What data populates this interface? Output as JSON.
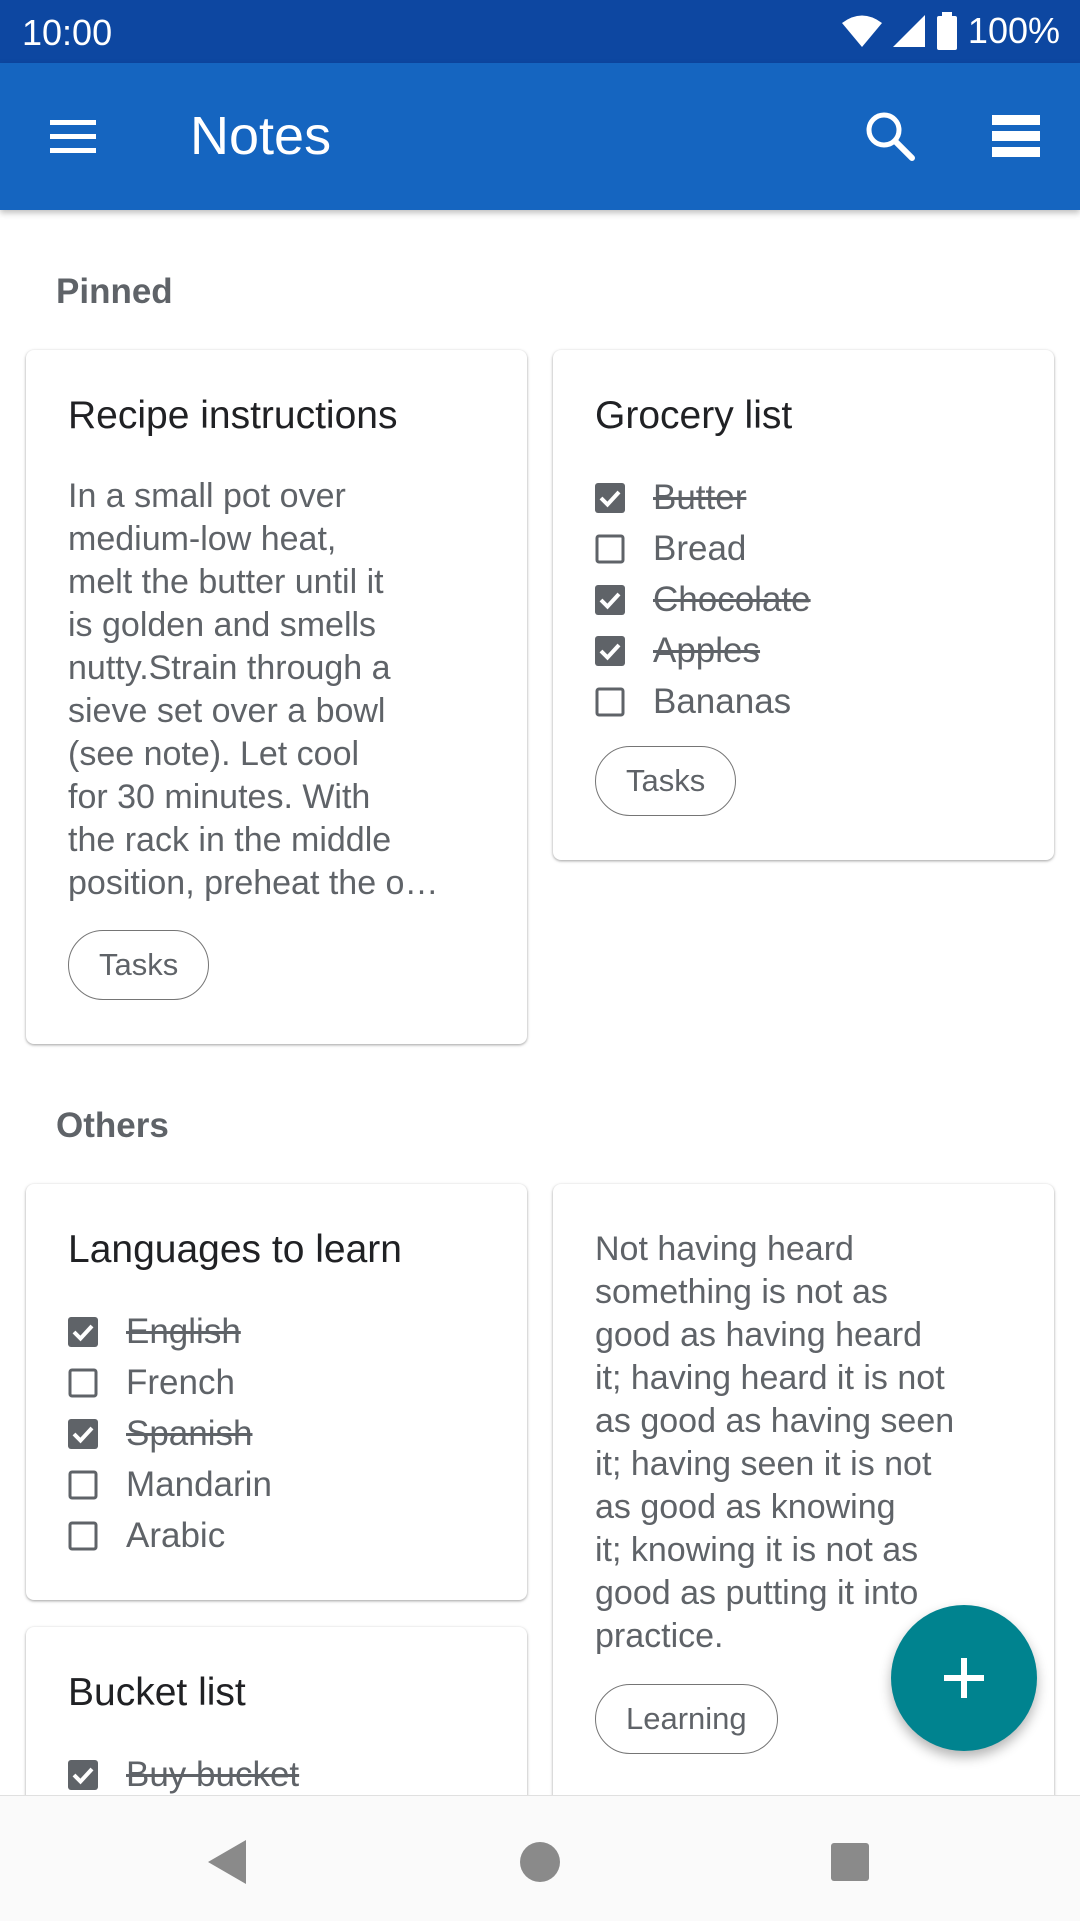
{
  "status_bar": {
    "time": "10:00",
    "battery": "100%"
  },
  "app_bar": {
    "title": "Notes",
    "menu_icon": "menu-icon",
    "search_icon": "search-icon",
    "view_icon": "view-list-icon"
  },
  "sections": {
    "pinned": "Pinned",
    "others": "Others"
  },
  "notes": {
    "recipe": {
      "title": "Recipe instructions",
      "lines": [
        "In a small pot over",
        "medium-low heat,",
        "melt the butter until it",
        "is golden and smells",
        "nutty.Strain through a",
        "sieve set over a bowl",
        "(see note). Let cool",
        "for 30 minutes. With",
        "the rack in the middle",
        "position, preheat the o…"
      ],
      "label": "Tasks"
    },
    "grocery": {
      "title": "Grocery list",
      "items": [
        {
          "text": "Butter",
          "checked": true
        },
        {
          "text": "Bread",
          "checked": false
        },
        {
          "text": "Chocolate",
          "checked": true
        },
        {
          "text": "Apples",
          "checked": true
        },
        {
          "text": "Bananas",
          "checked": false
        }
      ],
      "label": "Tasks"
    },
    "languages": {
      "title": "Languages to learn",
      "items": [
        {
          "text": "English",
          "checked": true
        },
        {
          "text": "French",
          "checked": false
        },
        {
          "text": "Spanish",
          "checked": true
        },
        {
          "text": "Mandarin",
          "checked": false
        },
        {
          "text": "Arabic",
          "checked": false
        }
      ]
    },
    "quote": {
      "lines": [
        "Not having heard",
        "something is not as",
        "good as having heard",
        "it; having heard it is not",
        "as good as having seen",
        "it; having seen it is not",
        "as good as knowing",
        "it; knowing it is not as",
        "good as putting it into",
        "practice."
      ],
      "label": "Learning"
    },
    "bucket": {
      "title": "Bucket list",
      "items": [
        {
          "text": "Buy bucket",
          "checked": true
        }
      ]
    }
  },
  "fab": {
    "icon": "add-icon"
  },
  "nav_bar": {
    "back_icon": "back-icon",
    "home_icon": "home-icon",
    "recents_icon": "recents-icon"
  },
  "colors": {
    "status_bar": "#0d47a1",
    "app_bar": "#1565c0",
    "fab": "#00838f"
  }
}
